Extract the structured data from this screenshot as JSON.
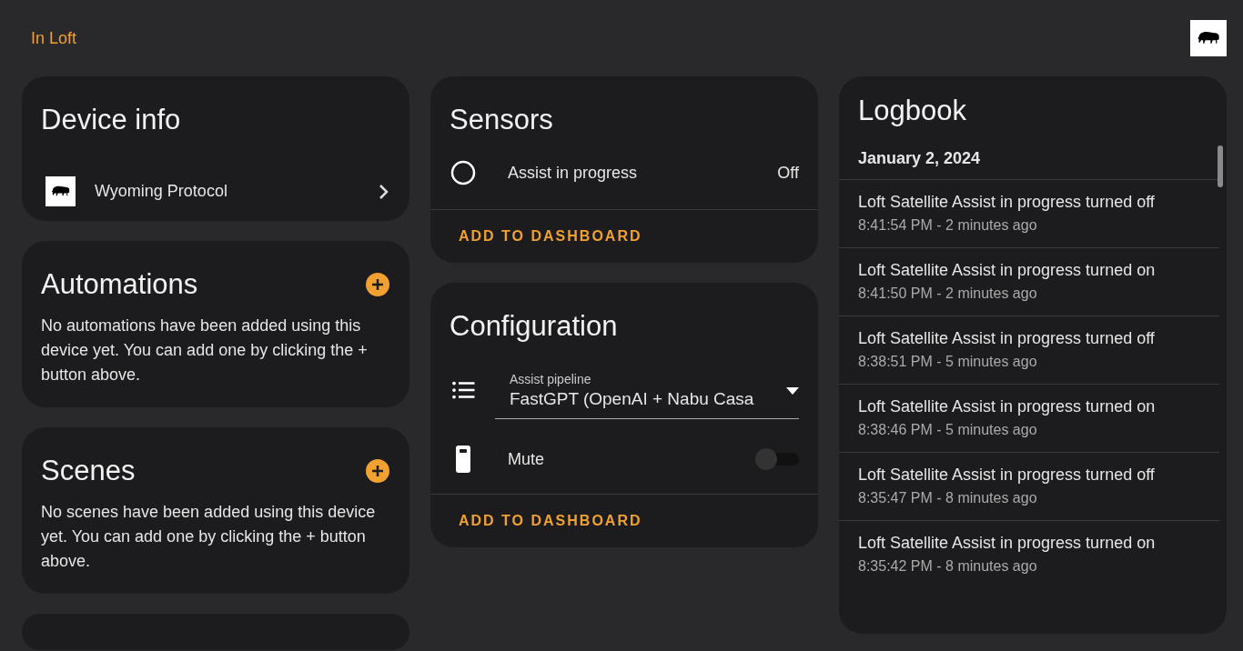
{
  "header": {
    "area": "In Loft"
  },
  "device_info": {
    "title": "Device info",
    "integration": "Wyoming Protocol"
  },
  "automations": {
    "title": "Automations",
    "text": "No automations have been added using this device yet. You can add one by clicking the + button above."
  },
  "scenes": {
    "title": "Scenes",
    "text": "No scenes have been added using this device yet. You can add one by clicking the + button above."
  },
  "sensors": {
    "title": "Sensors",
    "entities": [
      {
        "name": "Assist in progress",
        "state": "Off"
      }
    ],
    "action": "ADD TO DASHBOARD"
  },
  "configuration": {
    "title": "Configuration",
    "entities": [
      {
        "kind": "select",
        "label": "Assist pipeline",
        "value": "FastGPT (OpenAI + Nabu Casa"
      },
      {
        "kind": "switch",
        "name": "Mute",
        "on": false
      }
    ],
    "action": "ADD TO DASHBOARD"
  },
  "logbook": {
    "title": "Logbook",
    "date": "January 2, 2024",
    "entries": [
      {
        "message": "Loft Satellite Assist in progress turned off",
        "time": "8:41:54 PM - 2 minutes ago"
      },
      {
        "message": "Loft Satellite Assist in progress turned on",
        "time": "8:41:50 PM - 2 minutes ago"
      },
      {
        "message": "Loft Satellite Assist in progress turned off",
        "time": "8:38:51 PM - 5 minutes ago"
      },
      {
        "message": "Loft Satellite Assist in progress turned on",
        "time": "8:38:46 PM - 5 minutes ago"
      },
      {
        "message": "Loft Satellite Assist in progress turned off",
        "time": "8:35:47 PM - 8 minutes ago"
      },
      {
        "message": "Loft Satellite Assist in progress turned on",
        "time": "8:35:42 PM - 8 minutes ago"
      }
    ]
  }
}
